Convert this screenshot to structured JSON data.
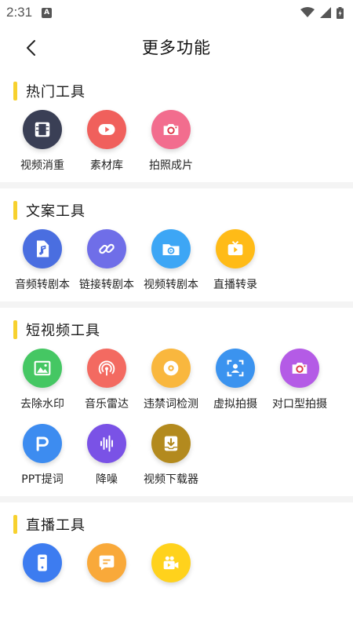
{
  "status": {
    "time": "2:31",
    "notif_letter": "A"
  },
  "nav": {
    "title": "更多功能"
  },
  "sections": [
    {
      "title": "热门工具",
      "items": [
        {
          "label": "视频消重",
          "icon": "film-icon",
          "color": "#3a3f55"
        },
        {
          "label": "素材库",
          "icon": "play-icon",
          "color": "#f0605c"
        },
        {
          "label": "拍照成片",
          "icon": "camera-icon",
          "color": "#f26d8e"
        }
      ]
    },
    {
      "title": "文案工具",
      "items": [
        {
          "label": "音频转剧本",
          "icon": "music-file-icon",
          "color": "#4a6ee0"
        },
        {
          "label": "链接转剧本",
          "icon": "link-icon",
          "color": "#6f6ee8"
        },
        {
          "label": "视频转剧本",
          "icon": "video-folder-icon",
          "color": "#3da6f5"
        },
        {
          "label": "直播转录",
          "icon": "tv-play-icon",
          "color": "#ffbb17"
        }
      ]
    },
    {
      "title": "短视频工具",
      "items": [
        {
          "label": "去除水印",
          "icon": "image-icon",
          "color": "#45c763"
        },
        {
          "label": "音乐雷达",
          "icon": "radar-icon",
          "color": "#f36a61"
        },
        {
          "label": "违禁词检测",
          "icon": "target-icon",
          "color": "#f9b73e"
        },
        {
          "label": "虚拟拍摄",
          "icon": "scan-person-icon",
          "color": "#3b93ef"
        },
        {
          "label": "对口型拍摄",
          "icon": "camera-icon",
          "color": "#b45be6"
        },
        {
          "label": "PPT提词",
          "icon": "p-letter-icon",
          "color": "#3d8cf0"
        },
        {
          "label": "降噪",
          "icon": "waveform-icon",
          "color": "#7a52e6"
        },
        {
          "label": "视频下载器",
          "icon": "download-tray-icon",
          "color": "#b38a1e"
        }
      ]
    },
    {
      "title": "直播工具",
      "items": [
        {
          "label": "",
          "icon": "phone-icon",
          "color": "#3d7cf0"
        },
        {
          "label": "",
          "icon": "chat-icon",
          "color": "#f9a93a"
        },
        {
          "label": "",
          "icon": "video-camera-icon",
          "color": "#ffd21c"
        }
      ]
    }
  ]
}
